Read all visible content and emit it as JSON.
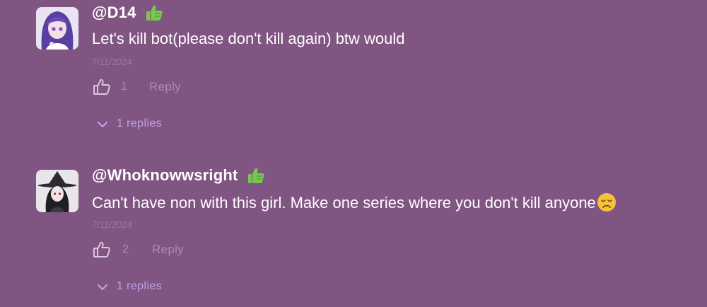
{
  "comments": [
    {
      "username": "@D14",
      "badge_icon": "thumbs-up-emoji",
      "text": "Let's kill bot(please don't kill again) btw would",
      "date": "7/11/2024",
      "like_icon": "thumbs-up-outline-icon",
      "likes": "1",
      "reply_label": "Reply",
      "replies_label": "1 replies"
    },
    {
      "username": "@Whoknowwsright",
      "badge_icon": "thumbs-up-emoji",
      "text": "Can't have non with this girl. Make one series where you don't kill anyone",
      "trailing_emoji": "disappointed-face-emoji",
      "date": "7/11/2024",
      "like_icon": "thumbs-up-outline-icon",
      "likes": "2",
      "reply_label": "Reply",
      "replies_label": "1 replies"
    }
  ],
  "colors": {
    "background": "#815582",
    "text": "#ffffff",
    "muted": "#a98aae",
    "date": "#9b78a0",
    "replies_accent": "#bfa3e8",
    "badge_green": "#78c850"
  }
}
